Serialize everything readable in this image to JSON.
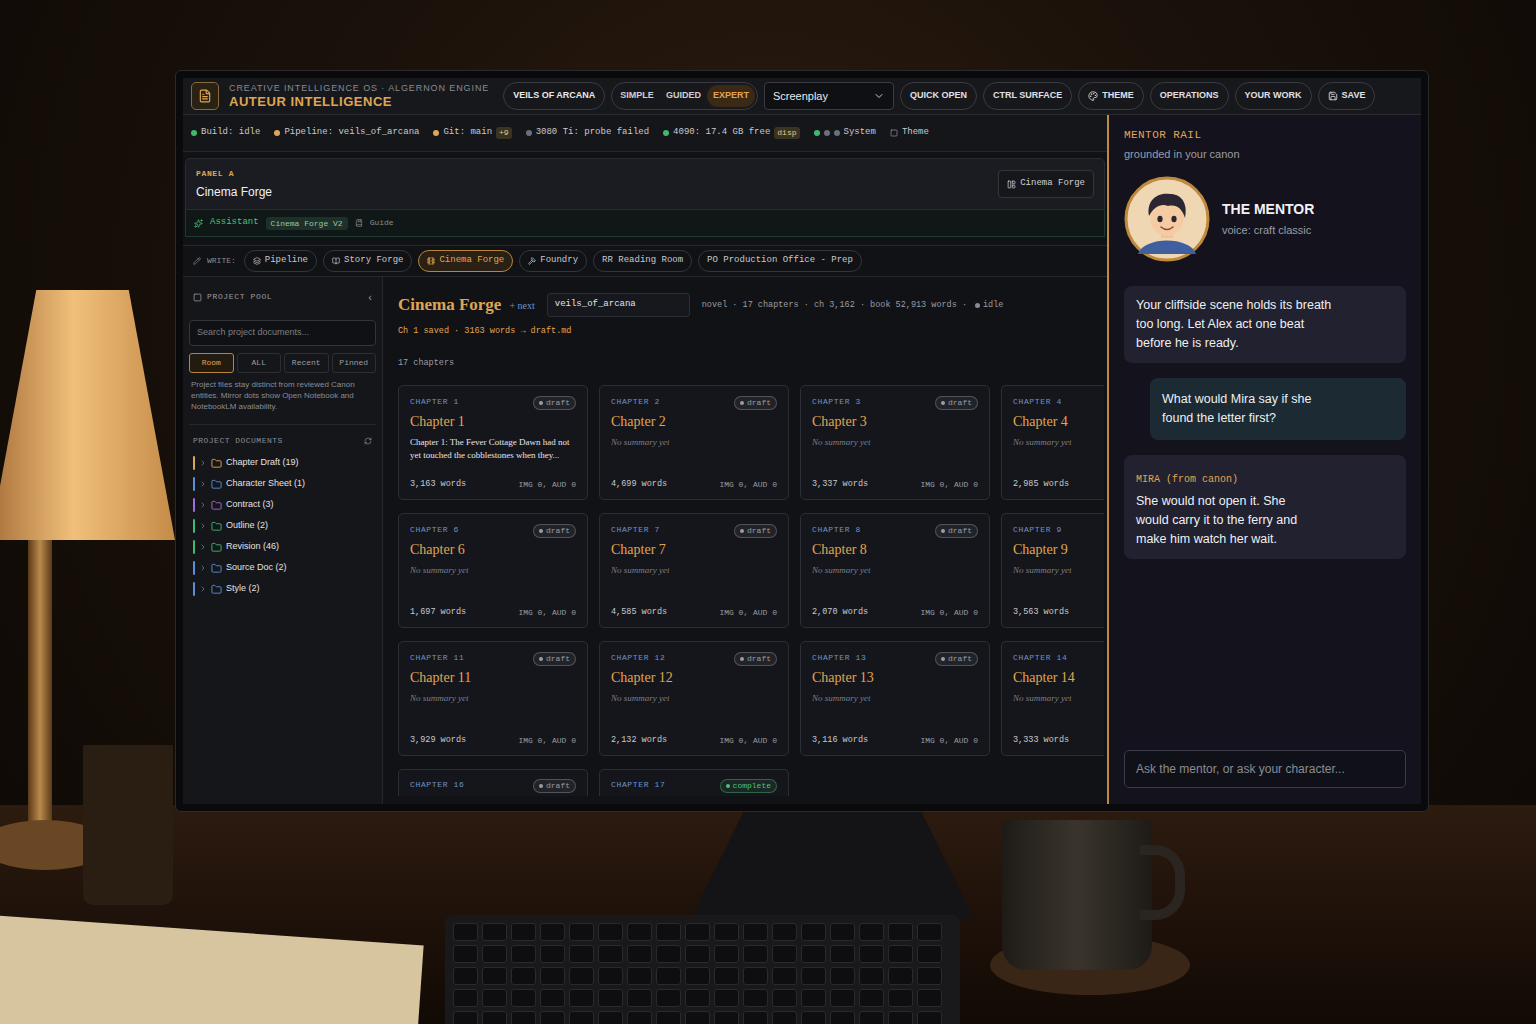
{
  "header": {
    "subtitle": "CREATIVE INTELLIGENCE OS · ALGERNON ENGINE",
    "title": "AUTEUR INTELLIGENCE",
    "project_button": "VEILS OF ARCANA",
    "modes": [
      {
        "label": "SIMPLE",
        "selected": false
      },
      {
        "label": "GUIDED",
        "selected": false
      },
      {
        "label": "EXPERT",
        "selected": true
      }
    ],
    "format_select": "Screenplay",
    "buttons": [
      {
        "label": "QUICK OPEN",
        "kind": "plain"
      },
      {
        "label": "CTRL SURFACE",
        "kind": "plain"
      },
      {
        "label": "THEME",
        "kind": "icon"
      },
      {
        "label": "OPERATIONS",
        "kind": "plain"
      },
      {
        "label": "YOUR WORK",
        "kind": "plain"
      },
      {
        "label": "SAVE",
        "kind": "icon"
      }
    ]
  },
  "status_bar": [
    {
      "label": "Build: idle",
      "kind": "dot",
      "dots": [
        "#3fb96b"
      ]
    },
    {
      "label": "Pipeline: veils_of_arcana",
      "kind": "dot",
      "dots": [
        "#e0a552"
      ]
    },
    {
      "label": "Git: main",
      "kind": "dot",
      "dots": [
        "#e0a552"
      ],
      "badge": "+9"
    },
    {
      "label": "3080 Ti: probe failed",
      "kind": "dot",
      "dots": [
        "#6b6f78"
      ]
    },
    {
      "label": "4090: 17.4 GB free",
      "kind": "dot",
      "dots": [
        "#3fb96b"
      ],
      "badge": "disp"
    },
    {
      "label": "System",
      "kind": "dot",
      "dots": [
        "#3fb96b",
        "#6b6f78",
        "#6b6f78"
      ]
    },
    {
      "label": "Theme",
      "kind": "icon",
      "dots": []
    }
  ],
  "panel_a": {
    "label": "PANEL A",
    "title": "Cinema Forge",
    "button": "Cinema Forge"
  },
  "assistant": {
    "label": "Assistant",
    "badge": "Cinema Forge V2",
    "guide": "Guide"
  },
  "write_bar": {
    "label": "WRITE:",
    "tabs": [
      {
        "label": "Pipeline",
        "kind": "icon",
        "selected": false
      },
      {
        "label": "Story Forge",
        "kind": "icon",
        "selected": false
      },
      {
        "label": "Cinema Forge",
        "kind": "icon",
        "selected": true
      },
      {
        "label": "Foundry",
        "kind": "icon",
        "selected": false
      },
      {
        "label": "RR Reading Room",
        "kind": "plain",
        "selected": false
      },
      {
        "label": "PO Production Office - Prep",
        "kind": "plain",
        "selected": false
      }
    ]
  },
  "sidebar": {
    "title": "PROJECT POOL",
    "collapse": "‹",
    "search_placeholder": "Search project documents...",
    "filters": [
      {
        "label": "Room",
        "selected": true
      },
      {
        "label": "ALL",
        "selected": false
      },
      {
        "label": "Recent",
        "selected": false
      },
      {
        "label": "Pinned",
        "selected": false
      }
    ],
    "note": "Project files stay distinct from reviewed Canon entities. Mirror dots show Open Notebook and NotebookLM availability.",
    "documents_title": "PROJECT DOCUMENTS",
    "folders": [
      {
        "label": "Chapter Draft (19)",
        "color": "#e0a552"
      },
      {
        "label": "Character Sheet (1)",
        "color": "#5b8fd6"
      },
      {
        "label": "Contract (3)",
        "color": "#a46bd6"
      },
      {
        "label": "Outline (2)",
        "color": "#3fb96b"
      },
      {
        "label": "Revision (46)",
        "color": "#3fb96b"
      },
      {
        "label": "Source Doc (2)",
        "color": "#5b8fd6"
      },
      {
        "label": "Style (2)",
        "color": "#5b8fd6"
      }
    ]
  },
  "main": {
    "title": "Cinema Forge",
    "next": "+ next",
    "project_field": "veils_of_arcana",
    "meta": "novel · 17 chapters · ch 3,162 · book 52,913 words ·",
    "status": "idle",
    "saved": "Ch 1 saved · 3163 words → draft.md",
    "count": "17 chapters",
    "chapters": [
      {
        "kind": "full",
        "label": "CHAPTER 1",
        "badge": "draft",
        "badge_color": "#9a9ca3",
        "title": "Chapter 1",
        "summary": "Chapter 1: The Fever Cottage Dawn had not yet touched the cobblestones when they...",
        "empty": false,
        "words": "3,163 words",
        "media": "IMG 0, AUD 0"
      },
      {
        "kind": "full",
        "label": "CHAPTER 2",
        "badge": "draft",
        "badge_color": "#9a9ca3",
        "title": "Chapter 2",
        "summary": "No summary yet",
        "empty": true,
        "words": "4,699 words",
        "media": "IMG 0, AUD 0"
      },
      {
        "kind": "full",
        "label": "CHAPTER 3",
        "badge": "draft",
        "badge_color": "#9a9ca3",
        "title": "Chapter 3",
        "summary": "No summary yet",
        "empty": true,
        "words": "3,337 words",
        "media": "IMG 0, AUD 0"
      },
      {
        "kind": "cut-right",
        "label": "CHAPTER 4",
        "title": "Chapter 4",
        "summary": "No summary yet",
        "empty": true,
        "words": "2,985 words"
      },
      {
        "kind": "full",
        "label": "CHAPTER 6",
        "badge": "draft",
        "badge_color": "#9a9ca3",
        "title": "Chapter 6",
        "summary": "No summary yet",
        "empty": true,
        "words": "1,697 words",
        "media": "IMG 0, AUD 0"
      },
      {
        "kind": "full",
        "label": "CHAPTER 7",
        "badge": "draft",
        "badge_color": "#9a9ca3",
        "title": "Chapter 7",
        "summary": "No summary yet",
        "empty": true,
        "words": "4,585 words",
        "media": "IMG 0, AUD 0"
      },
      {
        "kind": "full",
        "label": "CHAPTER 8",
        "badge": "draft",
        "badge_color": "#9a9ca3",
        "title": "Chapter 8",
        "summary": "No summary yet",
        "empty": true,
        "words": "2,070 words",
        "media": "IMG 0, AUD 0"
      },
      {
        "kind": "cut-right",
        "label": "CHAPTER 9",
        "title": "Chapter 9",
        "summary": "No summary yet",
        "empty": true,
        "words": "3,563 words"
      },
      {
        "kind": "full",
        "label": "CHAPTER 11",
        "badge": "draft",
        "badge_color": "#9a9ca3",
        "title": "Chapter 11",
        "summary": "No summary yet",
        "empty": true,
        "words": "3,929 words",
        "media": "IMG 0, AUD 0"
      },
      {
        "kind": "full",
        "label": "CHAPTER 12",
        "badge": "draft",
        "badge_color": "#9a9ca3",
        "title": "Chapter 12",
        "summary": "No summary yet",
        "empty": true,
        "words": "2,132 words",
        "media": "IMG 0, AUD 0"
      },
      {
        "kind": "full",
        "label": "CHAPTER 13",
        "badge": "draft",
        "badge_color": "#9a9ca3",
        "title": "Chapter 13",
        "summary": "No summary yet",
        "empty": true,
        "words": "3,116 words",
        "media": "IMG 0, AUD 0"
      },
      {
        "kind": "cut-right",
        "label": "CHAPTER 14",
        "title": "Chapter 14",
        "summary": "No summary yet",
        "empty": true,
        "words": "3,333 words"
      },
      {
        "kind": "cut-bottom",
        "label": "CHAPTER 16",
        "badge": "draft",
        "badge_color": "#9a9ca3"
      },
      {
        "kind": "cut-bottom",
        "label": "CHAPTER 17",
        "badge": "complete",
        "badge_color": "#4cc27a"
      }
    ]
  },
  "mentor_rail": {
    "title": "MENTOR RAIL",
    "subtitle": "grounded in your canon",
    "name": "THE MENTOR",
    "voice": "voice: craft classic",
    "messages": [
      {
        "kind": "mentor",
        "text": "Your cliffside scene holds its breath too long. Let Alex act one beat before he is ready."
      },
      {
        "kind": "user",
        "text": "What would Mira say if she found the letter first?"
      },
      {
        "kind": "character",
        "speaker": "MIRA (from canon)",
        "text": "She would not open it. She would carry it to the ferry and make him watch her wait."
      }
    ],
    "input_placeholder": "Ask the mentor, or ask your character..."
  }
}
